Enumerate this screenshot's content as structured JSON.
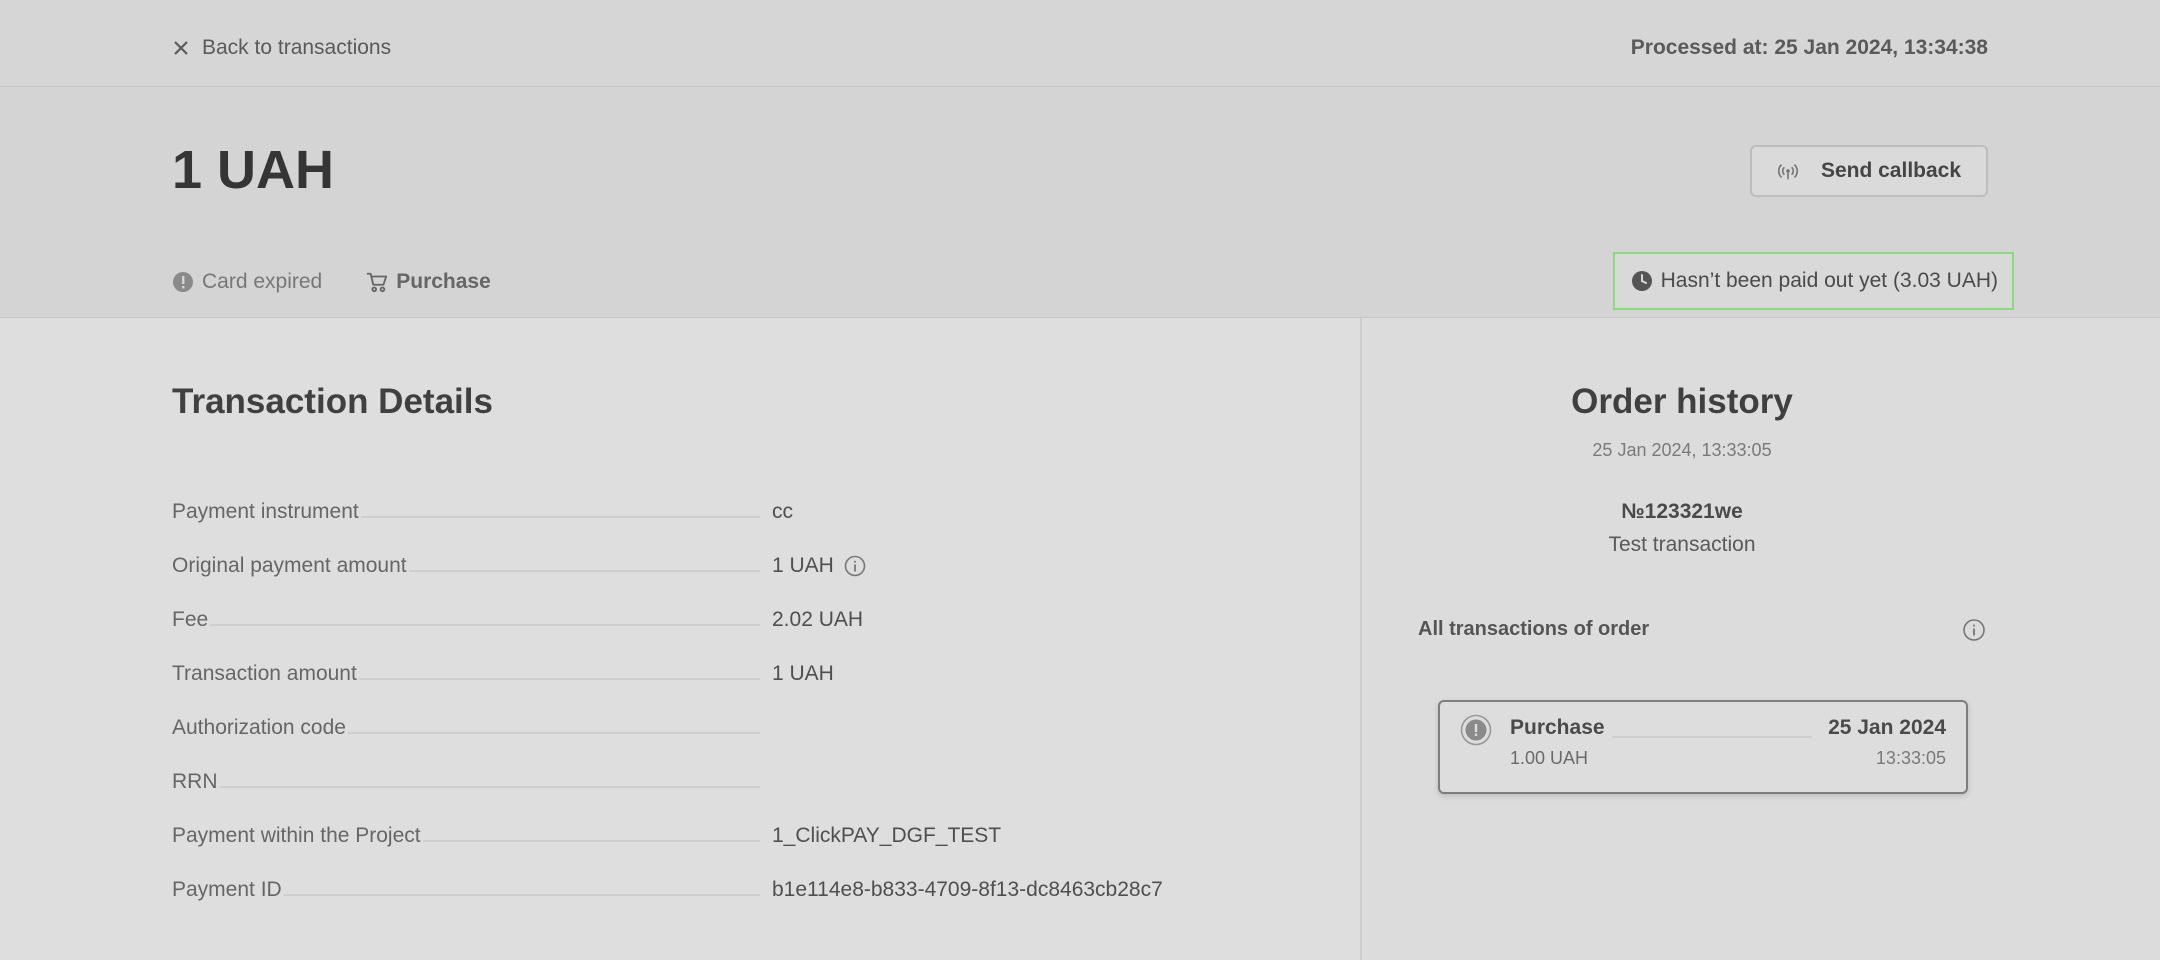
{
  "topbar": {
    "back_label": "Back to transactions",
    "processed_at": "Processed at: 25 Jan 2024, 13:34:38"
  },
  "header": {
    "amount": "1 UAH",
    "callback_label": "Send callback",
    "status_tag": "Card expired",
    "type_tag": "Purchase",
    "payout_status": "Hasn’t been paid out yet (3.03 UAH)",
    "payout_border_color": "#86dd7a"
  },
  "details": {
    "title": "Transaction Details",
    "rows": [
      {
        "label": "Payment instrument",
        "value": "cc"
      },
      {
        "label": "Original payment amount",
        "value": "1 UAH"
      },
      {
        "label": "Fee",
        "value": "2.02 UAH"
      },
      {
        "label": "Transaction amount",
        "value": "1 UAH"
      },
      {
        "label": "Authorization code",
        "value": ""
      },
      {
        "label": "RRN",
        "value": ""
      },
      {
        "label": "Payment within the Project",
        "value": "1_ClickPAY_DGF_TEST"
      },
      {
        "label": "Payment ID",
        "value": "b1e114e8-b833-4709-8f13-dc8463cb28c7"
      }
    ]
  },
  "history": {
    "title": "Order history",
    "date": "25 Jan 2024, 13:33:05",
    "order_number": "№123321we",
    "order_description": "Test transaction",
    "all_transactions_label": "All transactions of order",
    "transactions": [
      {
        "type": "Purchase",
        "amount": "1.00 UAH",
        "date": "25 Jan 2024",
        "time": "13:33:05"
      }
    ]
  }
}
